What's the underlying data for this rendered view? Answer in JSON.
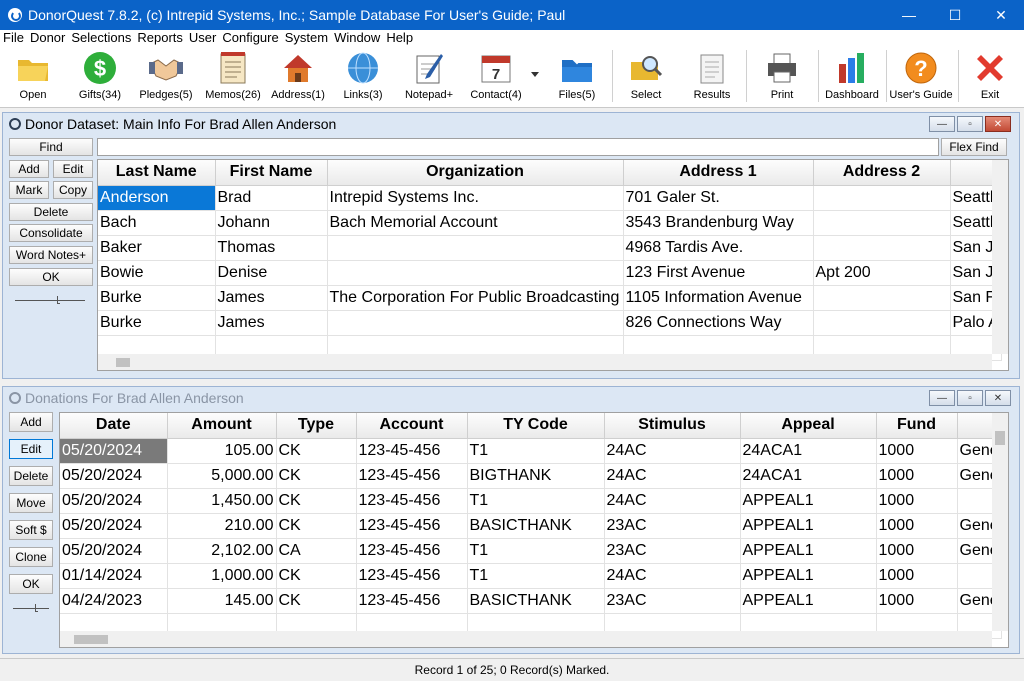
{
  "window": {
    "title": "DonorQuest 7.8.2, (c) Intrepid Systems, Inc.; Sample Database For User's Guide; Paul"
  },
  "menu": [
    "File",
    "Donor",
    "Selections",
    "Reports",
    "User",
    "Configure",
    "System",
    "Window",
    "Help"
  ],
  "toolbar": [
    {
      "label": "Open",
      "icon": "folder-icon"
    },
    {
      "label": "Gifts(34)",
      "icon": "dollar-icon"
    },
    {
      "label": "Pledges(5)",
      "icon": "handshake-icon"
    },
    {
      "label": "Memos(26)",
      "icon": "memo-icon"
    },
    {
      "label": "Address(1)",
      "icon": "house-icon"
    },
    {
      "label": "Links(3)",
      "icon": "globe-icon"
    },
    {
      "label": "Notepad+",
      "icon": "notepad-icon"
    },
    {
      "label": "Contact(4)",
      "icon": "calendar-icon"
    },
    {
      "label": "Files(5)",
      "icon": "files-icon"
    },
    {
      "label": "Select",
      "icon": "magnifier-icon"
    },
    {
      "label": "Results",
      "icon": "results-icon"
    },
    {
      "label": "Print",
      "icon": "printer-icon"
    },
    {
      "label": "Dashboard",
      "icon": "bar-chart-icon"
    },
    {
      "label": "User's Guide",
      "icon": "help-icon"
    },
    {
      "label": "Exit",
      "icon": "exit-icon"
    }
  ],
  "donor_panel": {
    "title": "Donor Dataset: Main Info For Brad Allen Anderson",
    "buttons": {
      "find": "Find",
      "add": "Add",
      "edit": "Edit",
      "mark": "Mark",
      "copy": "Copy",
      "delete": "Delete",
      "consolidate": "Consolidate",
      "word_notes": "Word Notes+",
      "ok": "OK"
    },
    "flex_find": "Flex Find",
    "search_value": "",
    "columns": [
      "Last Name",
      "First Name",
      "Organization",
      "Address 1",
      "Address 2",
      ""
    ],
    "rows": [
      [
        "Anderson",
        "Brad",
        "Intrepid Systems Inc.",
        "701 Galer St.",
        "",
        "Seattl"
      ],
      [
        "Bach",
        "Johann",
        "Bach Memorial Account",
        "3543 Brandenburg Way",
        "",
        "Seattl"
      ],
      [
        "Baker",
        "Thomas",
        "",
        "4968 Tardis Ave.",
        "",
        "San J"
      ],
      [
        "Bowie",
        "Denise",
        "",
        "123 First Avenue",
        "Apt 200",
        "San J"
      ],
      [
        "Burke",
        "James",
        "The Corporation For Public Broadcasting",
        "1105 Information Avenue",
        "",
        "San F"
      ],
      [
        "Burke",
        "James",
        "",
        "826 Connections Way",
        "",
        "Palo A"
      ]
    ]
  },
  "donations_panel": {
    "title": "Donations For Brad Allen Anderson",
    "buttons": {
      "add": "Add",
      "edit": "Edit",
      "delete": "Delete",
      "move": "Move",
      "soft": "Soft $",
      "clone": "Clone",
      "ok": "OK"
    },
    "columns": [
      "Date",
      "Amount",
      "Type",
      "Account",
      "TY Code",
      "Stimulus",
      "Appeal",
      "Fund",
      ""
    ],
    "rows": [
      [
        "05/20/2024",
        "105.00",
        "CK",
        "123-45-456",
        "T1",
        "24AC",
        "24ACA1",
        "1000",
        "Gene"
      ],
      [
        "05/20/2024",
        "5,000.00",
        "CK",
        "123-45-456",
        "BIGTHANK",
        "24AC",
        "24ACA1",
        "1000",
        "Gene"
      ],
      [
        "05/20/2024",
        "1,450.00",
        "CK",
        "123-45-456",
        "T1",
        "24AC",
        "APPEAL1",
        "1000",
        ""
      ],
      [
        "05/20/2024",
        "210.00",
        "CK",
        "123-45-456",
        "BASICTHANK",
        "23AC",
        "APPEAL1",
        "1000",
        "Gene"
      ],
      [
        "05/20/2024",
        "2,102.00",
        "CA",
        "123-45-456",
        "T1",
        "23AC",
        "APPEAL1",
        "1000",
        "Gene"
      ],
      [
        "01/14/2024",
        "1,000.00",
        "CK",
        "123-45-456",
        "T1",
        "24AC",
        "APPEAL1",
        "1000",
        ""
      ],
      [
        "04/24/2023",
        "145.00",
        "CK",
        "123-45-456",
        "BASICTHANK",
        "23AC",
        "APPEAL1",
        "1000",
        "Gene"
      ]
    ]
  },
  "status": "Record 1 of 25; 0 Record(s) Marked."
}
